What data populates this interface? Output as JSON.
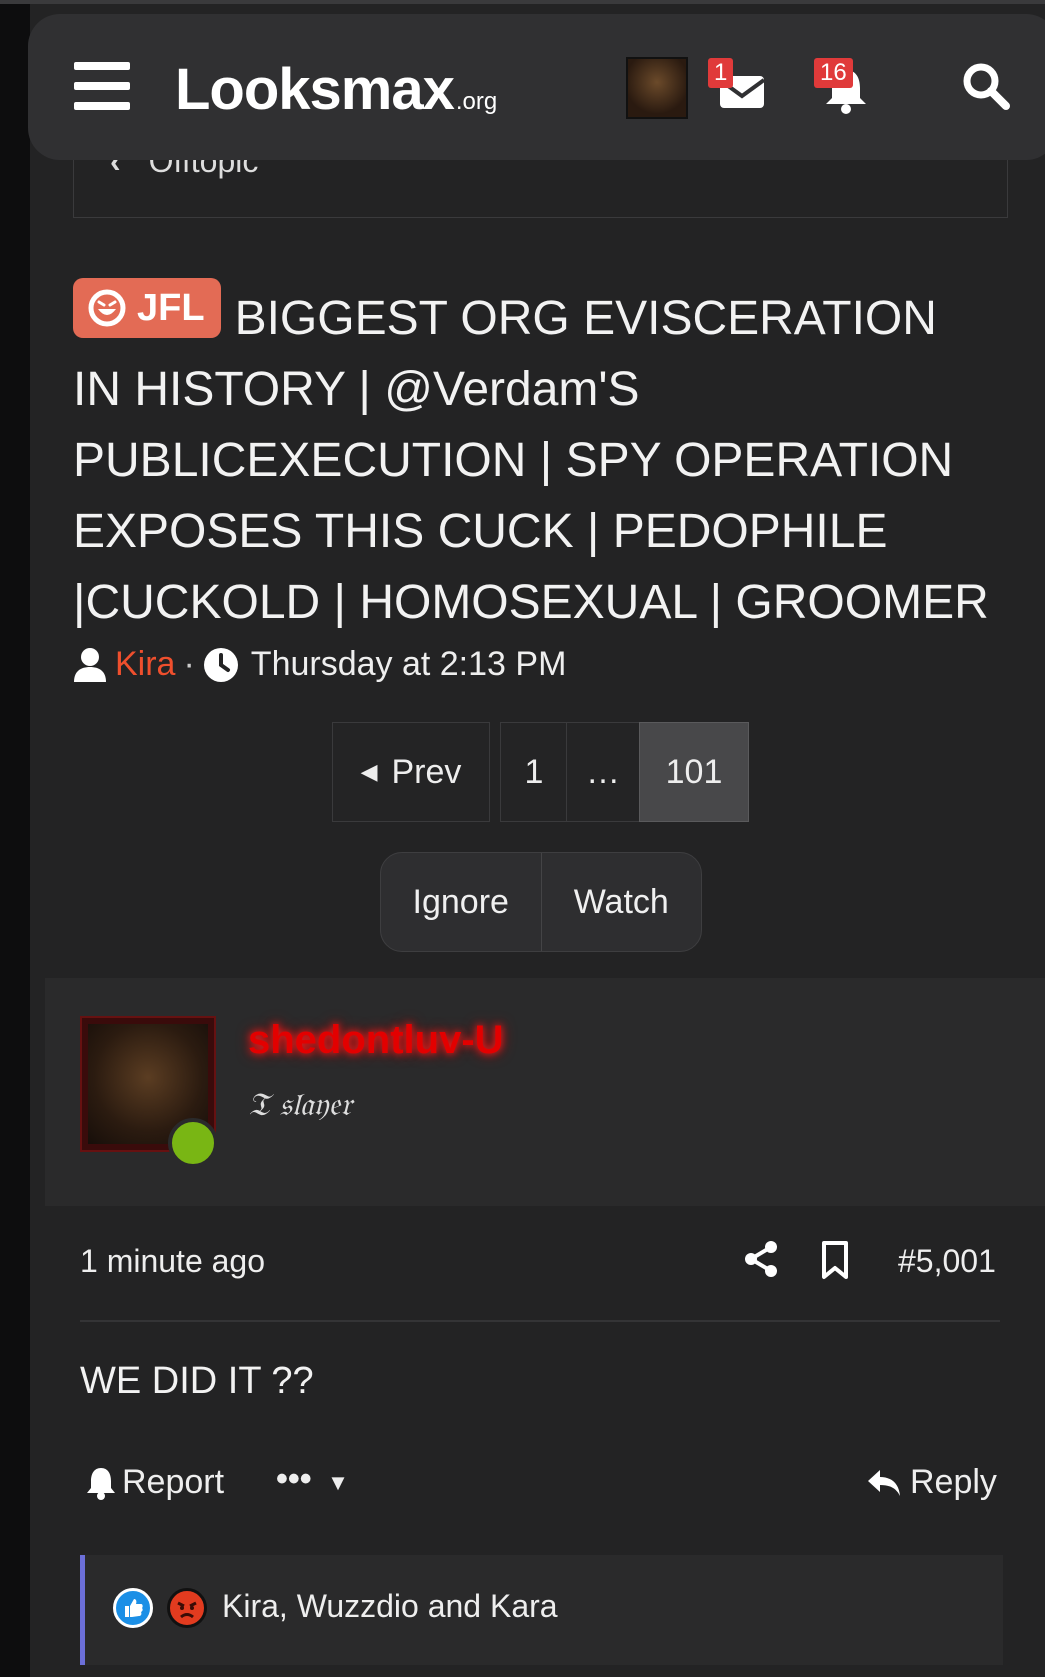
{
  "header": {
    "logo_main": "Looksmax",
    "logo_suffix": ".org",
    "messages_badge": "1",
    "alerts_badge": "16"
  },
  "breadcrumb": {
    "label": "Offtopic"
  },
  "thread": {
    "prefix": "JFL",
    "title": "BIGGEST ORG EVISCERATION IN HISTORY | @Verdam'S PUBLICEXECUTION | SPY OPERATION EXPOSES THIS CUCK | PEDOPHILE |CUCKOLD | HOMOSEXUAL | GROOMER",
    "author": "Kira",
    "separator": "·",
    "date": "Thursday at 2:13 PM"
  },
  "pagination": {
    "prev": "Prev",
    "first": "1",
    "ellipsis": "…",
    "current": "101"
  },
  "actions": {
    "ignore": "Ignore",
    "watch": "Watch"
  },
  "post": {
    "username": "shedontluv-U",
    "user_title": "𝔗 𝔰𝔩𝔞𝔶𝔢𝔯",
    "time": "1 minute ago",
    "number": "#5,001",
    "body": "WE DID IT ??",
    "report": "Report",
    "more": "•••",
    "reply": "Reply",
    "reactions_text": "Kira, Wuzzdio and Kara"
  },
  "colors": {
    "accent_orange": "#e36b55",
    "author_red": "#ef4f2d",
    "username_red": "#e30000",
    "online_green": "#79b614",
    "reaction_border": "#6c6fd8"
  }
}
